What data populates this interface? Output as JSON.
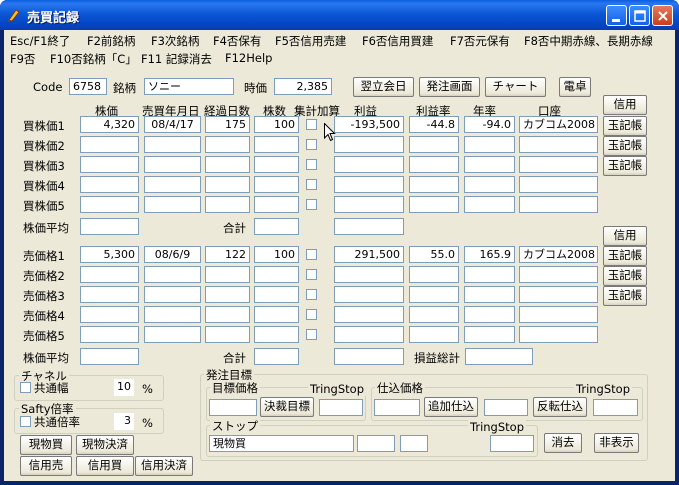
{
  "window": {
    "title": "売買記録"
  },
  "menu": [
    "Esc/F1終了",
    "F2前銘柄",
    "F3次銘柄",
    "F4否保有",
    "F5否信用売建",
    "F6否信用買建",
    "F7否元保有",
    "F8否中期赤線、長期赤線",
    "F9否",
    "F10否銘柄「C」",
    "F11 記録消去",
    "F12Help"
  ],
  "header": {
    "code_label": "Code",
    "code_value": "6758",
    "name_label": "銘柄",
    "name_value": "ソニー",
    "price_label": "時価",
    "price_value": "2,385",
    "btn_next_day": "翌立会日",
    "btn_order": "発注画面",
    "btn_chart": "チャート",
    "btn_calc": "電卓"
  },
  "columns": {
    "price": "株価",
    "date": "売買年月日",
    "days": "経過日数",
    "shares": "株数",
    "sum": "集計加算",
    "profit": "利益",
    "profit_rate": "利益率",
    "annual": "年率",
    "account": "口座"
  },
  "buy": {
    "rows": [
      {
        "label": "買株価1",
        "price": "4,320",
        "date": "08/4/17",
        "days": "175",
        "shares": "100",
        "profit": "-193,500",
        "rate": "-44.8",
        "annual": "-94.0",
        "account": "カブコム2008"
      },
      {
        "label": "買株価2",
        "price": "",
        "date": "",
        "days": "",
        "shares": "",
        "profit": "",
        "rate": "",
        "annual": "",
        "account": ""
      },
      {
        "label": "買株価3",
        "price": "",
        "date": "",
        "days": "",
        "shares": "",
        "profit": "",
        "rate": "",
        "annual": "",
        "account": ""
      },
      {
        "label": "買株価4",
        "price": "",
        "date": "",
        "days": "",
        "shares": "",
        "profit": "",
        "rate": "",
        "annual": "",
        "account": ""
      },
      {
        "label": "買株価5",
        "price": "",
        "date": "",
        "days": "",
        "shares": "",
        "profit": "",
        "rate": "",
        "annual": "",
        "account": ""
      }
    ],
    "avg_label": "株価平均",
    "total_label": "合計",
    "side_buttons": [
      "信用",
      "玉記帳",
      "玉記帳",
      "玉記帳"
    ]
  },
  "sell": {
    "rows": [
      {
        "label": "売価格1",
        "price": "5,300",
        "date": "08/6/9",
        "days": "122",
        "shares": "100",
        "profit": "291,500",
        "rate": "55.0",
        "annual": "165.9",
        "account": "カブコム2008"
      },
      {
        "label": "売価格2",
        "price": "",
        "date": "",
        "days": "",
        "shares": "",
        "profit": "",
        "rate": "",
        "annual": "",
        "account": ""
      },
      {
        "label": "売価格3",
        "price": "",
        "date": "",
        "days": "",
        "shares": "",
        "profit": "",
        "rate": "",
        "annual": "",
        "account": ""
      },
      {
        "label": "売価格4",
        "price": "",
        "date": "",
        "days": "",
        "shares": "",
        "profit": "",
        "rate": "",
        "annual": "",
        "account": ""
      },
      {
        "label": "売価格5",
        "price": "",
        "date": "",
        "days": "",
        "shares": "",
        "profit": "",
        "rate": "",
        "annual": "",
        "account": ""
      }
    ],
    "avg_label": "株価平均",
    "total_label": "合計",
    "pl_total_label": "損益総計",
    "side_buttons": [
      "信用",
      "玉記帳",
      "玉記帳",
      "玉記帳"
    ]
  },
  "channel": {
    "title": "チャネル",
    "check_label": "共通幅",
    "value": "10",
    "unit": "%"
  },
  "safety": {
    "title": "Safty倍率",
    "check_label": "共通倍率",
    "value": "3",
    "unit": "%"
  },
  "bottom_buttons": [
    "現物買",
    "現物決済",
    "信用売",
    "信用買",
    "信用決済"
  ],
  "order": {
    "title": "発注目標",
    "target_title": "目標価格",
    "tring1": "TringStop",
    "btn_decide": "決裁目標",
    "entry_title": "仕込価格",
    "tring2": "TringStop",
    "btn_add": "追加仕込",
    "btn_reverse": "反転仕込",
    "stop_title": "ストップ",
    "tring3": "TringStop",
    "stop_value": "現物買",
    "btn_clear": "消去",
    "btn_hide": "非表示"
  }
}
